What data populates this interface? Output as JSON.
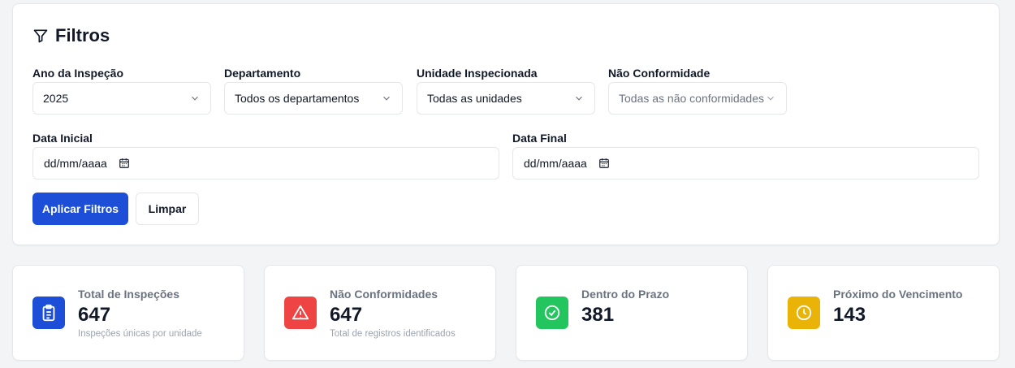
{
  "filters": {
    "title": "Filtros",
    "year": {
      "label": "Ano da Inspeção",
      "value": "2025"
    },
    "department": {
      "label": "Departamento",
      "value": "Todos os departamentos"
    },
    "unit": {
      "label": "Unidade Inspecionada",
      "value": "Todas as unidades"
    },
    "nonconformity": {
      "label": "Não Conformidade",
      "value": "Todas as não conformidades"
    },
    "start_date": {
      "label": "Data Inicial",
      "value": "dd/mm/aaaa"
    },
    "end_date": {
      "label": "Data Final",
      "value": "dd/mm/aaaa"
    },
    "apply_label": "Aplicar Filtros",
    "clear_label": "Limpar"
  },
  "stats": [
    {
      "label": "Total de Inspeções",
      "value": "647",
      "sub": "Inspeções únicas por unidade",
      "icon": "clipboard-list-icon",
      "color": "#1d4ed8"
    },
    {
      "label": "Não Conformidades",
      "value": "647",
      "sub": "Total de registros identificados",
      "icon": "alert-triangle-icon",
      "color": "#ef4444"
    },
    {
      "label": "Dentro do Prazo",
      "value": "381",
      "sub": "",
      "icon": "check-circle-icon",
      "color": "#22c55e"
    },
    {
      "label": "Próximo do Vencimento",
      "value": "143",
      "sub": "",
      "icon": "clock-icon",
      "color": "#eab308"
    }
  ]
}
